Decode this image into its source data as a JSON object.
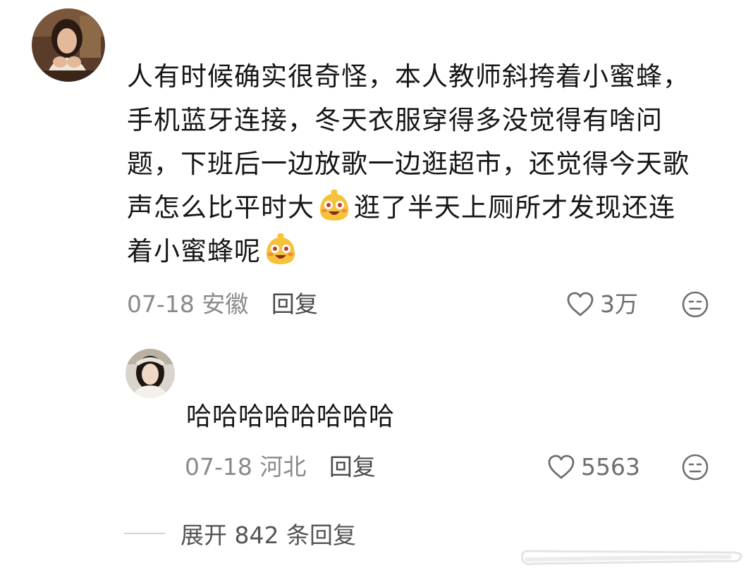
{
  "comment": {
    "text_lines": [
      "人有时候确实很奇怪，本人教师斜挎着小蜜蜂，",
      "手机蓝牙连接，冬天衣服穿得多没觉得有啥问",
      "题，下班后一边放歌一边逛超市，还觉得今天歌",
      [
        "声怎么比平时大",
        "逛了半天上厕所才发现还连"
      ],
      "着小蜜蜂呢"
    ],
    "emoji": "laughing-face-emoji",
    "date": "07-18",
    "location": "安徽",
    "reply_label": "回复",
    "likes": "3万"
  },
  "reply": {
    "text": "哈哈哈哈哈哈哈哈",
    "date": "07-18",
    "location": "河北",
    "reply_label": "回复",
    "likes": "5563"
  },
  "expand": {
    "label": "展开 842 条回复"
  },
  "colors": {
    "text": "#161616",
    "meta": "#8a8a8a",
    "emoji_face": "#f6c23a",
    "emoji_cheek": "#f08a3c"
  }
}
